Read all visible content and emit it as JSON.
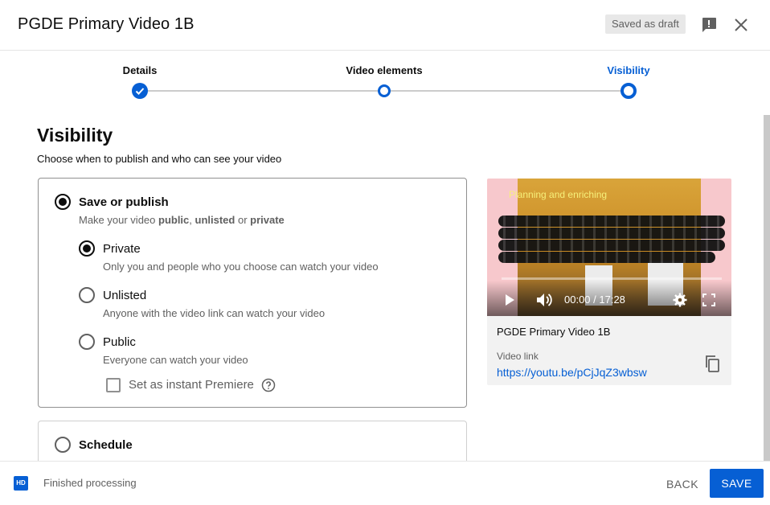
{
  "header": {
    "title": "PGDE Primary Video 1B",
    "draft_status": "Saved as draft",
    "feedback_icon": "feedback-icon",
    "close_icon": "close-icon"
  },
  "stepper": {
    "steps": [
      {
        "label": "Details",
        "state": "done"
      },
      {
        "label": "Video elements",
        "state": "incomplete"
      },
      {
        "label": "Visibility",
        "state": "current"
      }
    ]
  },
  "visibility": {
    "title": "Visibility",
    "subtitle": "Choose when to publish and who can see your video",
    "save_publish": {
      "label": "Save or publish",
      "desc_prefix": "Make your video ",
      "desc_public": "public",
      "desc_sep": ", ",
      "desc_unlisted": "unlisted",
      "desc_or": " or ",
      "desc_private": "private",
      "selected": true,
      "options": [
        {
          "label": "Private",
          "desc": "Only you and people who you choose can watch your video",
          "selected": true
        },
        {
          "label": "Unlisted",
          "desc": "Anyone with the video link can watch your video",
          "selected": false
        },
        {
          "label": "Public",
          "desc": "Everyone can watch your video",
          "selected": false
        }
      ],
      "premiere_label": "Set as instant Premiere",
      "premiere_checked": false
    },
    "schedule": {
      "label": "Schedule",
      "selected": false
    }
  },
  "video": {
    "thumb_text": "Planning and enriching",
    "time_display": "00:00 / 17:28",
    "name": "PGDE Primary Video 1B",
    "link_label": "Video link",
    "link_url": "https://youtu.be/pCjJqZ3wbsw"
  },
  "footer": {
    "hd_badge": "HD",
    "status": "Finished processing",
    "back_label": "BACK",
    "save_label": "SAVE"
  },
  "colors": {
    "accent": "#065fd4",
    "text_primary": "#0d0d0d",
    "text_secondary": "#606060"
  }
}
